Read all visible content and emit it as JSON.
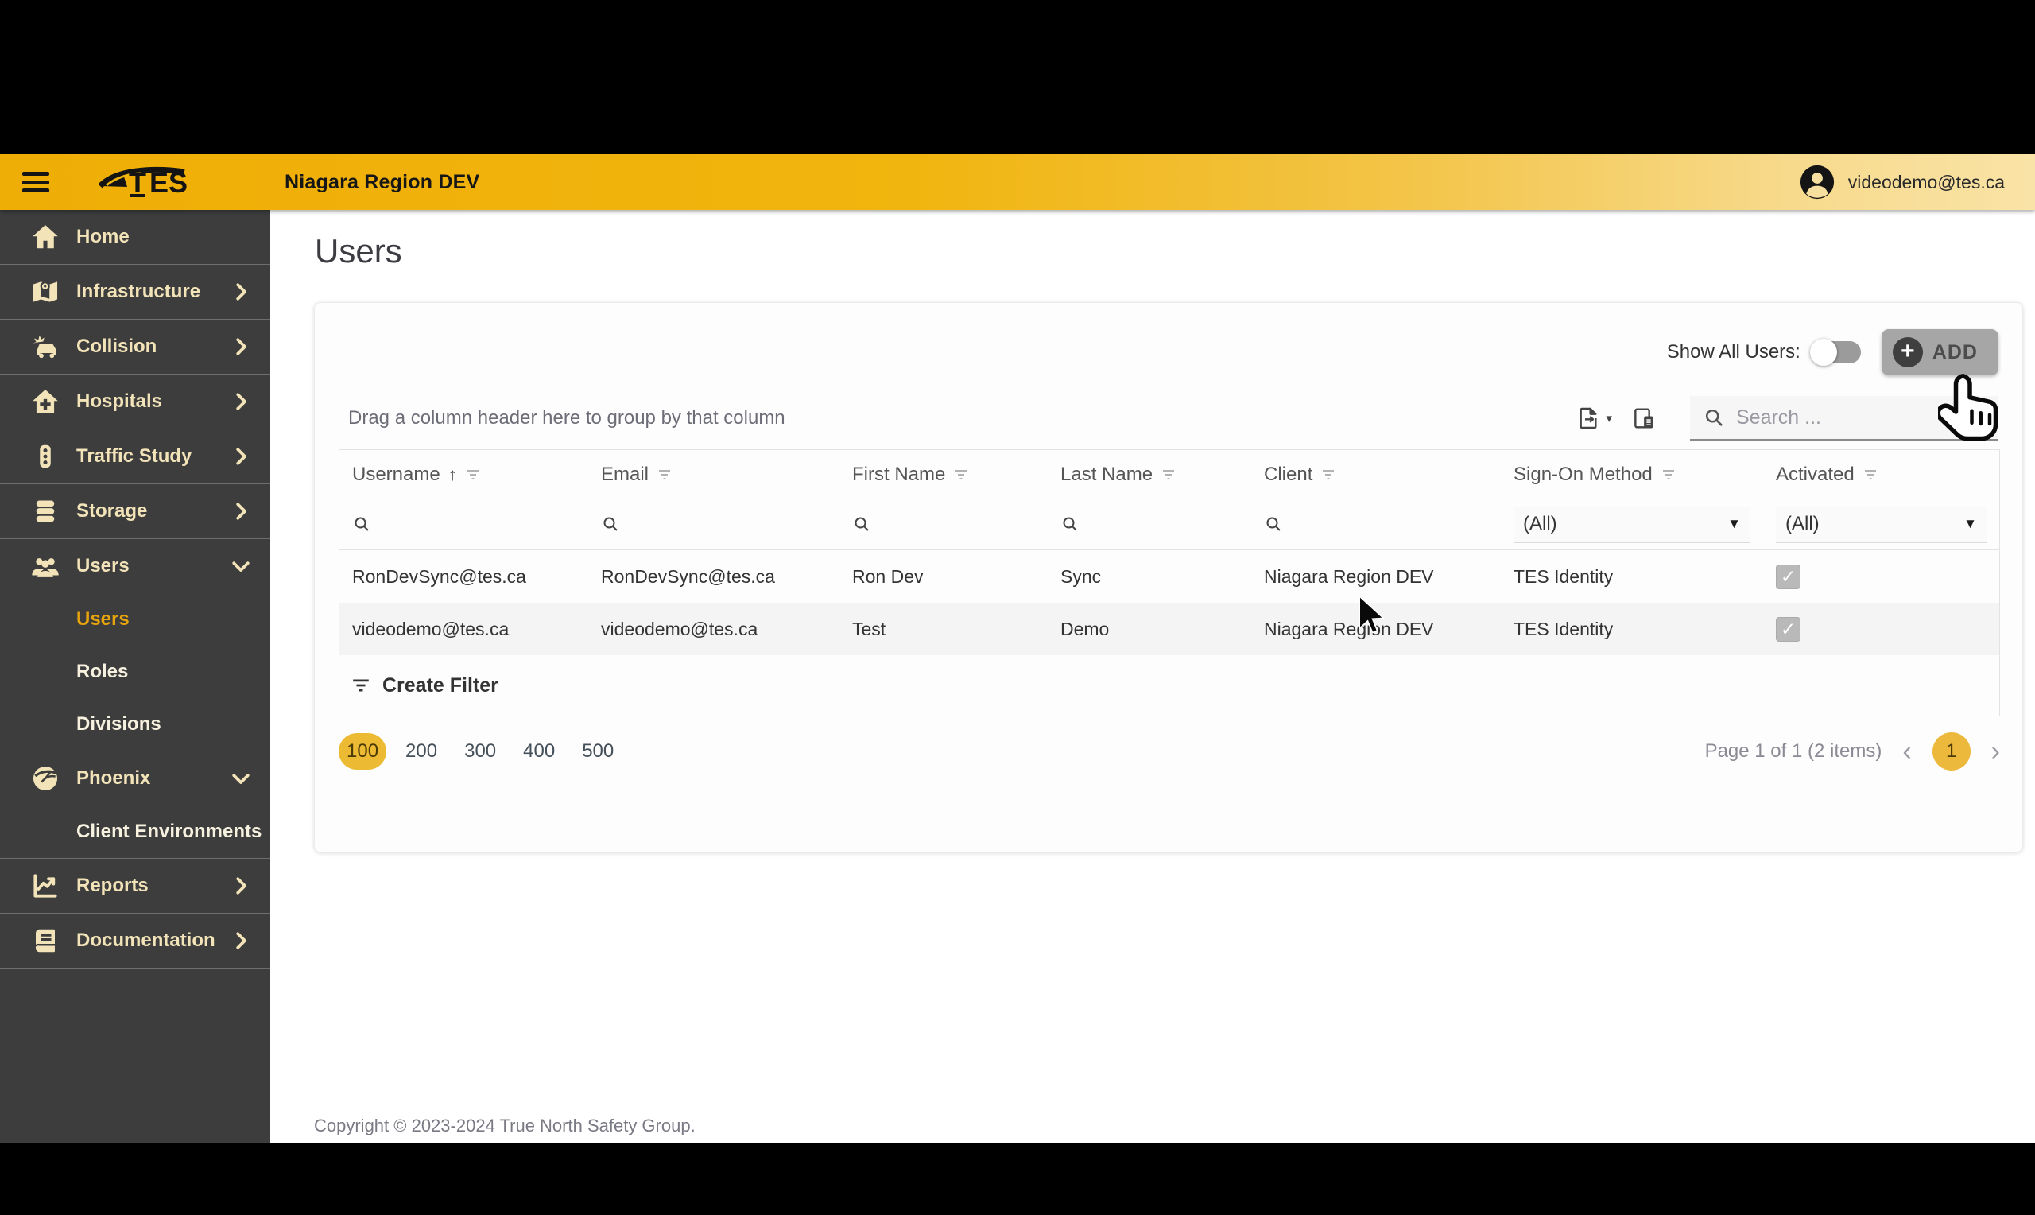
{
  "header": {
    "logo_text": "TES",
    "title": "Niagara Region DEV",
    "user_email": "videodemo@tes.ca"
  },
  "sidebar": {
    "items": [
      {
        "label": "Home",
        "icon": "home-icon"
      },
      {
        "label": "Infrastructure",
        "icon": "map-icon",
        "expand": "right"
      },
      {
        "label": "Collision",
        "icon": "car-crash-icon",
        "expand": "right"
      },
      {
        "label": "Hospitals",
        "icon": "hospital-icon",
        "expand": "right"
      },
      {
        "label": "Traffic Study",
        "icon": "traffic-light-icon",
        "expand": "right"
      },
      {
        "label": "Storage",
        "icon": "database-icon",
        "expand": "right"
      },
      {
        "label": "Users",
        "icon": "users-icon",
        "expand": "down",
        "children": [
          "Users",
          "Roles",
          "Divisions"
        ],
        "active_child": "Users"
      },
      {
        "label": "Phoenix",
        "icon": "phoenix-icon",
        "expand": "down",
        "children": [
          "Client Environments"
        ]
      },
      {
        "label": "Reports",
        "icon": "chart-icon",
        "expand": "right"
      },
      {
        "label": "Documentation",
        "icon": "book-icon",
        "expand": "right"
      }
    ]
  },
  "page": {
    "title": "Users"
  },
  "toolbar": {
    "show_all_label": "Show All Users:",
    "show_all_state": "off",
    "add_label": "ADD"
  },
  "grid": {
    "drag_hint": "Drag a column header here to group by that column",
    "search_placeholder": "Search ...",
    "columns": [
      "Username",
      "Email",
      "First Name",
      "Last Name",
      "Client",
      "Sign-On Method",
      "Activated"
    ],
    "sorted_column": "Username",
    "sort_direction": "ascending",
    "filter_all": "(All)",
    "rows": [
      {
        "username": "RonDevSync@tes.ca",
        "email": "RonDevSync@tes.ca",
        "first_name": "Ron Dev",
        "last_name": "Sync",
        "client": "Niagara Region DEV",
        "sign_on": "TES Identity",
        "activated": true
      },
      {
        "username": "videodemo@tes.ca",
        "email": "videodemo@tes.ca",
        "first_name": "Test",
        "last_name": "Demo",
        "client": "Niagara Region DEV",
        "sign_on": "TES Identity",
        "activated": true
      }
    ],
    "create_filter_label": "Create Filter",
    "page_sizes": [
      "100",
      "200",
      "300",
      "400",
      "500"
    ],
    "selected_page_size": "100",
    "page_info": "Page 1 of 1 (2 items)",
    "current_page": "1"
  },
  "footer": {
    "copyright": "Copyright © 2023-2024 True North Safety Group."
  },
  "icons": {
    "sort_up": "↑",
    "dropdown_caret": "▼",
    "export_caret": "▾",
    "prev": "‹",
    "next": "›",
    "plus": "+",
    "check": "✓"
  },
  "colors": {
    "header_gold": "#f1b50f",
    "header_gold_light": "#f9e3a6",
    "sidebar_bg": "#3d3d3d",
    "sidebar_text": "#f2e3b8",
    "active_gold": "#e8a40c",
    "pill_gold": "#ecba33",
    "row_alt": "#f4f4f4"
  }
}
